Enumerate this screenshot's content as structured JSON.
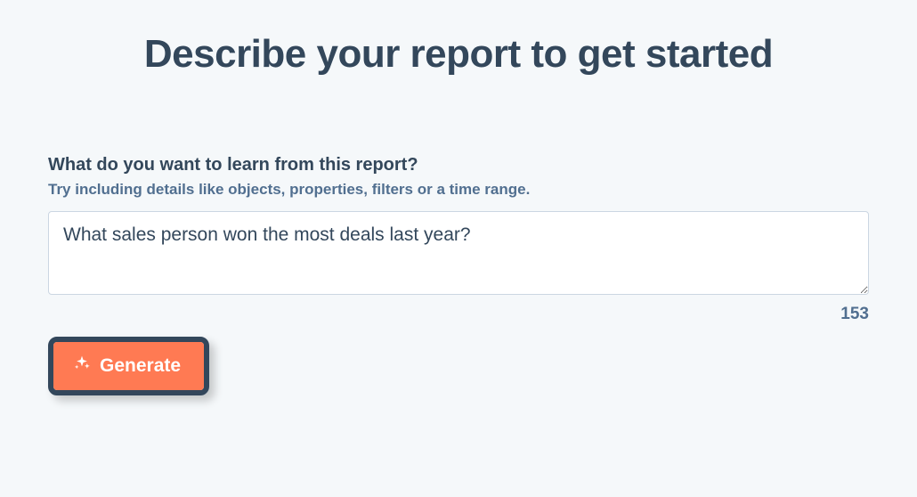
{
  "header": {
    "title": "Describe your report to get started"
  },
  "form": {
    "label": "What do you want to learn from this report?",
    "hint": "Try including details like objects, properties, filters or a time range.",
    "value": "What sales person won the most deals last year?",
    "remaining": "153"
  },
  "actions": {
    "generate_label": "Generate"
  }
}
